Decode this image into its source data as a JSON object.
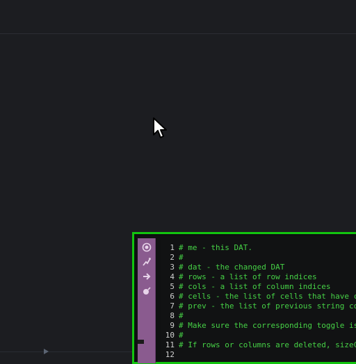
{
  "editor": {
    "lines": [
      {
        "num": "1",
        "text": "# me - this DAT."
      },
      {
        "num": "2",
        "text": "#"
      },
      {
        "num": "3",
        "text": "# dat - the changed DAT"
      },
      {
        "num": "4",
        "text": "# rows - a list of row indices"
      },
      {
        "num": "5",
        "text": "# cols - a list of column indices"
      },
      {
        "num": "6",
        "text": "# cells - the list of cells that have ch"
      },
      {
        "num": "7",
        "text": "# prev - the list of previous string co"
      },
      {
        "num": "8",
        "text": "#"
      },
      {
        "num": "9",
        "text": "# Make sure the corresponding toggle is"
      },
      {
        "num": "10",
        "text": "#"
      },
      {
        "num": "11",
        "text": "# If rows or columns are deleted, sizeC"
      },
      {
        "num": "12",
        "text": ""
      }
    ]
  },
  "toolbar": {
    "buttons": [
      "viewer-toggle-icon",
      "bypass-icon",
      "export-arrow-icon",
      "cook-icon"
    ]
  },
  "colors": {
    "background": "#1c1d21",
    "node_border": "#12c40f",
    "toolbar": "#8a5b8f",
    "code_text": "#46d246"
  }
}
